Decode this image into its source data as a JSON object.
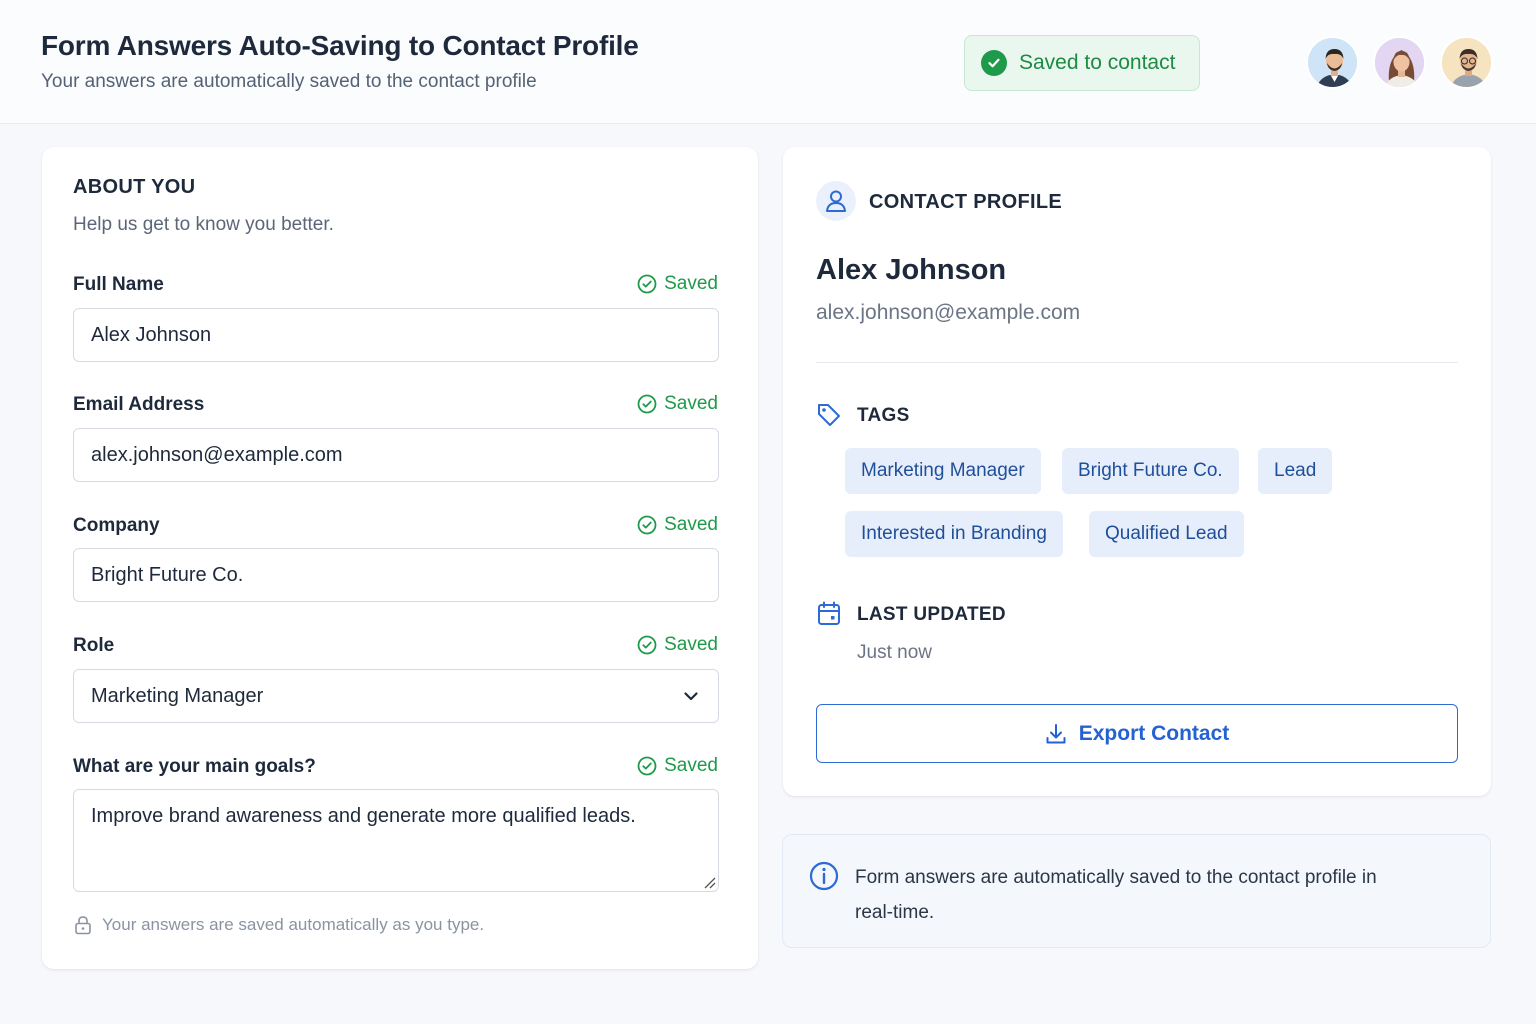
{
  "header": {
    "title": "Form Answers Auto-Saving to Contact Profile",
    "subtitle": "Your answers are automatically saved to the contact profile",
    "status_badge": "Saved to contact",
    "avatars": [
      "avatar-man-blue",
      "avatar-woman-purple",
      "avatar-man-beige"
    ]
  },
  "form": {
    "title": "ABOUT YOU",
    "subtitle": "Help us get to know you better.",
    "saved_label": "Saved",
    "fields": [
      {
        "label": "Full Name",
        "value": "Alex Johnson"
      },
      {
        "label": "Email Address",
        "value": "alex.johnson@example.com"
      },
      {
        "label": "Company",
        "value": "Bright Future Co."
      },
      {
        "label": "Role",
        "value": "Marketing Manager"
      },
      {
        "label": "What are your main goals?",
        "value": "Improve brand awareness and generate more qualified leads."
      }
    ],
    "footnote": "Your answers are saved automatically as you type."
  },
  "profile": {
    "title": "CONTACT PROFILE",
    "name": "Alex Johnson",
    "email": "alex.johnson@example.com",
    "tags_label": "TAGS",
    "tags": [
      "Marketing Manager",
      "Bright Future Co.",
      "Lead",
      "Interested in Branding",
      "Qualified Lead"
    ],
    "last_updated_label": "LAST UPDATED",
    "last_updated_value": "Just now",
    "export_label": "Export Contact"
  },
  "info": {
    "text": "Form answers are automatically saved to the contact profile in real-time."
  },
  "colors": {
    "accent": "#2562d1",
    "success": "#1e9a4a",
    "chip_bg": "#e6eefb"
  }
}
